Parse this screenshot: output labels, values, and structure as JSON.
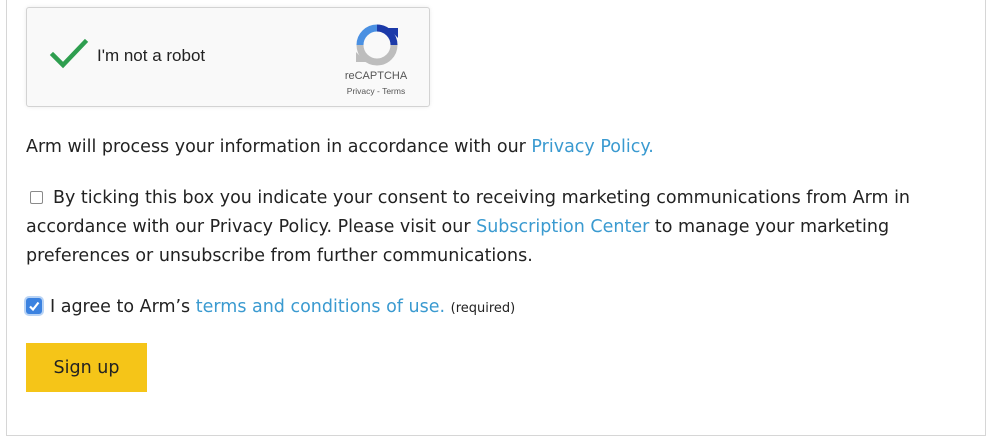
{
  "recaptcha": {
    "label": "I'm not a robot",
    "checked": true,
    "brand": "reCAPTCHA",
    "privacy_link": "Privacy",
    "separator": " - ",
    "terms_link": "Terms"
  },
  "privacy_note": {
    "text": "Arm will process your information in accordance with our ",
    "link": "Privacy Policy."
  },
  "marketing_consent": {
    "checked": false,
    "text_before": "By ticking this box you indicate your consent to receiving marketing communications from Arm in accordance with our Privacy Policy. Please visit our ",
    "link": "Subscription Center",
    "text_after": " to manage your marketing preferences or unsubscribe from further communications."
  },
  "terms_agreement": {
    "checked": true,
    "text_before": "I agree to Arm’s ",
    "link": "terms and conditions of use.",
    "required_note": "(required)"
  },
  "signup_button": {
    "label": "Sign up"
  },
  "colors": {
    "link": "#3a9ad0",
    "button": "#f5c518",
    "checkbox_checked": "#3b82e0",
    "check_green": "#2e9e4f"
  }
}
